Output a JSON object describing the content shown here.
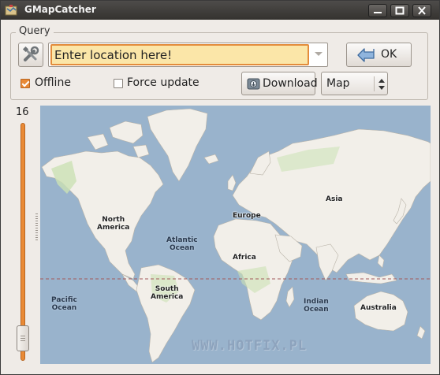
{
  "window": {
    "title": "GMapCatcher",
    "minimize_icon": "minimize-icon",
    "maximize_icon": "maximize-icon",
    "close_icon": "close-icon"
  },
  "query": {
    "legend": "Query",
    "location_value": "Enter location here!",
    "ok_label": "OK",
    "offline_label": "Offline",
    "offline_checked": true,
    "force_update_label": "Force update",
    "force_update_checked": false,
    "download_label": "Download",
    "map_type_value": "Map"
  },
  "zoom": {
    "level": "16"
  },
  "map": {
    "labels": {
      "north_america": "North\nAmerica",
      "south_america": "South\nAmerica",
      "europe": "Europe",
      "africa": "Africa",
      "asia": "Asia",
      "australia": "Australia",
      "atlantic": "Atlantic\nOcean",
      "pacific": "Pacific\nOcean",
      "indian": "Indian\nOcean"
    },
    "watermark": "WWW.HOTFIX.PL",
    "colors": {
      "water": "#99b3cc",
      "land": "#f2efe9",
      "vegetation": "#cbe1b4",
      "equator": "#a35a5a"
    }
  }
}
